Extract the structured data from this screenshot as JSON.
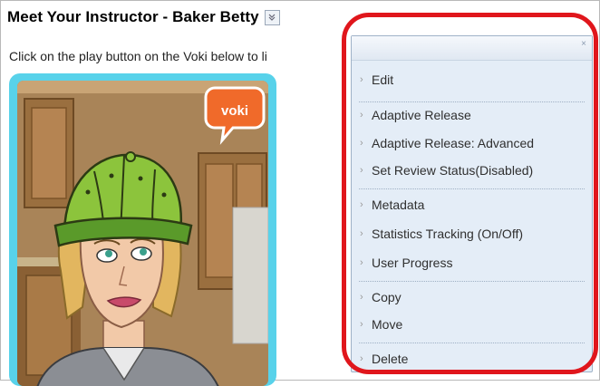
{
  "page": {
    "title": "Meet Your Instructor - Baker Betty",
    "instruction": "Click on the play button on the Voki below to li"
  },
  "voki": {
    "badge_text": "voki"
  },
  "context_menu": {
    "close_symbol": "×",
    "items": [
      {
        "label": "Edit"
      },
      {
        "label": "Adaptive Release"
      },
      {
        "label": "Adaptive Release: Advanced"
      },
      {
        "label": "Set Review Status(Disabled)"
      },
      {
        "label": "Metadata"
      },
      {
        "label": "Statistics Tracking (On/Off)"
      },
      {
        "label": "User Progress"
      },
      {
        "label": "Copy"
      },
      {
        "label": "Move"
      },
      {
        "label": "Delete"
      }
    ]
  },
  "colors": {
    "highlight_outline": "#e0161c",
    "menu_background": "#e4edf7",
    "voki_frame": "#58d2ea",
    "voki_badge": "#f06a2a",
    "hat": "#8cc43c"
  },
  "icons": {
    "title_dropdown": "chevron-down-icon",
    "menu_item": "chevron-right-icon",
    "menu_close": "close-icon"
  }
}
